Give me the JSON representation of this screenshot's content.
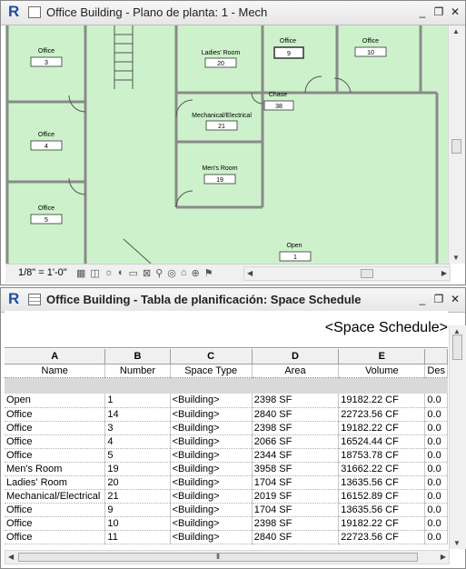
{
  "plan_window": {
    "title": "Office Building - Plano de planta: 1 - Mech",
    "scale": "1/8\" = 1'-0\"",
    "rooms": [
      {
        "name": "Office",
        "number": "3"
      },
      {
        "name": "Office",
        "number": "4"
      },
      {
        "name": "Office",
        "number": "5"
      },
      {
        "name": "Ladies' Room",
        "number": "20"
      },
      {
        "name": "Mechanical/Electrical",
        "number": "21"
      },
      {
        "name": "Men's Room",
        "number": "19"
      },
      {
        "name": "Office",
        "number": "9"
      },
      {
        "name": "Office",
        "number": "10"
      },
      {
        "name": "Chase",
        "number": "38"
      },
      {
        "name": "Open",
        "number": "1"
      }
    ]
  },
  "schedule_window": {
    "title": "Office Building - Tabla de planificación: Space Schedule",
    "schedule_title": "<Space Schedule>",
    "column_letters": [
      "A",
      "B",
      "C",
      "D",
      "E",
      ""
    ],
    "headers": [
      "Name",
      "Number",
      "Space Type",
      "Area",
      "Volume",
      "Des"
    ],
    "rows": [
      [
        "Open",
        "1",
        "<Building>",
        "2398 SF",
        "19182.22 CF",
        "0.0"
      ],
      [
        "Office",
        "14",
        "<Building>",
        "2840 SF",
        "22723.56 CF",
        "0.0"
      ],
      [
        "Office",
        "3",
        "<Building>",
        "2398 SF",
        "19182.22 CF",
        "0.0"
      ],
      [
        "Office",
        "4",
        "<Building>",
        "2066 SF",
        "16524.44 CF",
        "0.0"
      ],
      [
        "Office",
        "5",
        "<Building>",
        "2344 SF",
        "18753.78 CF",
        "0.0"
      ],
      [
        "Men's Room",
        "19",
        "<Building>",
        "3958 SF",
        "31662.22 CF",
        "0.0"
      ],
      [
        "Ladies' Room",
        "20",
        "<Building>",
        "1704 SF",
        "13635.56 CF",
        "0.0"
      ],
      [
        "Mechanical/Electrical",
        "21",
        "<Building>",
        "2019 SF",
        "16152.89 CF",
        "0.0"
      ],
      [
        "Office",
        "9",
        "<Building>",
        "1704 SF",
        "13635.56 CF",
        "0.0"
      ],
      [
        "Office",
        "10",
        "<Building>",
        "2398 SF",
        "19182.22 CF",
        "0.0"
      ],
      [
        "Office",
        "11",
        "<Building>",
        "2840 SF",
        "22723.56 CF",
        "0.0"
      ]
    ]
  },
  "window_controls": {
    "minimize": "_",
    "restore": "❐",
    "close": "✕"
  },
  "scrollbar_grip": "⦀"
}
